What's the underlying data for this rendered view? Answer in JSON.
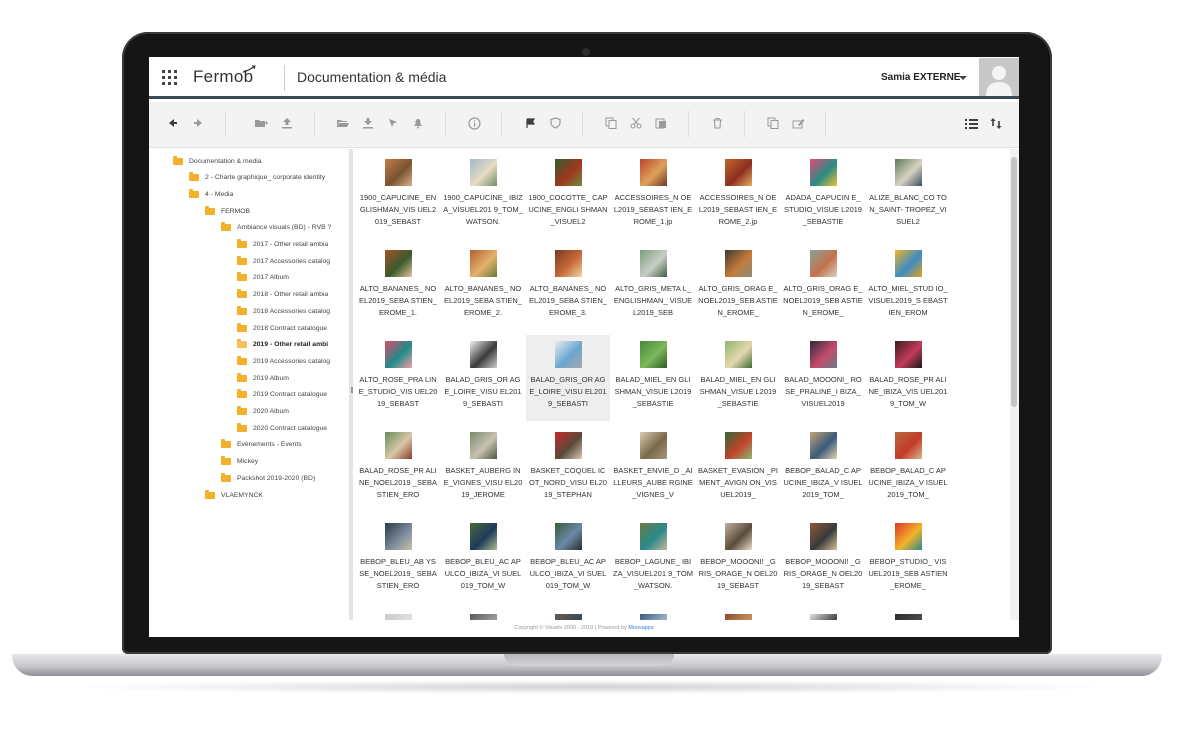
{
  "header": {
    "logo": "Fermob",
    "title": "Documentation & média",
    "user": "Samia EXTERNE",
    "icons": [
      "apps-grid-icon",
      "caret-down-icon",
      "avatar-icon"
    ]
  },
  "toolbar": {
    "icons": [
      "arrow-left-icon",
      "arrow-right-icon",
      "new-folder-icon",
      "upload-icon",
      "open-folder-icon",
      "download-icon",
      "cursor-icon",
      "bell-icon",
      "info-icon",
      "flag-icon",
      "shield-icon",
      "copy-icon",
      "cut-icon",
      "paste-icon",
      "delete-icon",
      "duplicate-icon",
      "rename-icon",
      "list-view-icon",
      "sort-icon"
    ]
  },
  "tree": [
    {
      "label": "Documentation & media",
      "level": 0
    },
    {
      "label": "2 - Charte graphique_ corporate identity",
      "level": 1
    },
    {
      "label": "4 - Media",
      "level": 1
    },
    {
      "label": "FERMOB",
      "level": 2
    },
    {
      "label": "Ambiance visuals (BD) - RVB ?",
      "level": 3
    },
    {
      "label": "2017 - Other retail ambia",
      "level": 4
    },
    {
      "label": "2017 Accessories catalog",
      "level": 4
    },
    {
      "label": "2017 Album",
      "level": 4
    },
    {
      "label": "2018 - Other retail ambia",
      "level": 4
    },
    {
      "label": "2018 Accessories catalog",
      "level": 4
    },
    {
      "label": "2018 Contract catalogue",
      "level": 4
    },
    {
      "label": "2019 - Other retail ambi",
      "level": 4,
      "active": true
    },
    {
      "label": "2019 Accessories catalog",
      "level": 4
    },
    {
      "label": "2019 Album",
      "level": 4
    },
    {
      "label": "2019 Contract catalogue",
      "level": 4
    },
    {
      "label": "2020 Album",
      "level": 4
    },
    {
      "label": "2020 Contract catalogue",
      "level": 4
    },
    {
      "label": "Evènements - Events",
      "level": 3
    },
    {
      "label": "Mickey",
      "level": 3
    },
    {
      "label": "Packshot 2019-2020 (BD)",
      "level": 3
    },
    {
      "label": "VLAEMYNCK",
      "level": 2
    }
  ],
  "files": [
    {
      "name": "1900_CAPUCINE_ ENGLISHMAN_VIS UEL2019_SEBAST",
      "colors": [
        "#c57c4a",
        "#7a5330",
        "#d9b18a"
      ]
    },
    {
      "name": "1900_CAPUCINE_ IBIZA_VISUEL201 9_TOM_WATSON.",
      "colors": [
        "#9fb9c9",
        "#e8dcc2",
        "#6f8c6a"
      ]
    },
    {
      "name": "1900_COCOTTE_ CAPUCINE_ENGLI SHMAN_VISUEL2",
      "colors": [
        "#2f5f2c",
        "#a1361f",
        "#6d8e3d"
      ]
    },
    {
      "name": "ACCESSOIRES_N OEL2019_SEBAST IEN_EROME_1.jp",
      "colors": [
        "#b8452a",
        "#e0a05c",
        "#6a3a22"
      ]
    },
    {
      "name": "ACCESSOIRES_N OEL2019_SEBAST IEN_EROME_2.jp",
      "colors": [
        "#c0672b",
        "#8d2f1f",
        "#e2b063"
      ]
    },
    {
      "name": "ADADA_CAPUCIN E_STUDIO_VISUE L2019_SEBASTIE",
      "colors": [
        "#e24a7a",
        "#2a8c84",
        "#f1c232"
      ]
    },
    {
      "name": "ALIZE_BLANC_CO TON_SAINT- TROPEZ_VISUEL2",
      "colors": [
        "#5a7a5c",
        "#d9d2c2",
        "#3a4e63"
      ]
    },
    {
      "name": "ALTO_BANANES_ NOEL2019_SEBA STIEN_EROME_1.",
      "colors": [
        "#a4522c",
        "#3b5a2c",
        "#e3c49a"
      ]
    },
    {
      "name": "ALTO_BANANES_ NOEL2019_SEBA STIEN_EROME_2.",
      "colors": [
        "#b65b2c",
        "#e4b36d",
        "#6a7a3a"
      ]
    },
    {
      "name": "ALTO_BANANES_ NOEL2019_SEBA STIEN_EROME_3.",
      "colors": [
        "#7a3a22",
        "#c86a3a",
        "#f0d7a8"
      ]
    },
    {
      "name": "ALTO_GRIS_META L_ENGLISHMAN_ VISUEL2019_SEB",
      "colors": [
        "#7b9d7a",
        "#c8cfc6",
        "#3f5d46"
      ]
    },
    {
      "name": "ALTO_GRIS_ORAG E_NOEL2019_SEB ASTIEN_EROME_",
      "colors": [
        "#3a3a34",
        "#c47b3a",
        "#8a8c7a"
      ]
    },
    {
      "name": "ALTO_GRIS_ORAG E_NOEL2019_SEB ASTIEN_EROME_",
      "colors": [
        "#8aa39a",
        "#c4714a",
        "#d8d2c4"
      ]
    },
    {
      "name": "ALTO_MIEL_STUD IO_VISUEL2019_S EBASTIEN_EROM",
      "colors": [
        "#f0b428",
        "#3a8cc4",
        "#e6a21e"
      ]
    },
    {
      "name": "ALTO_ROSE_PRA LINE_STUDIO_VIS UEL2019_SEBAST",
      "colors": [
        "#e04a6a",
        "#1f8c8a",
        "#f2a0a8"
      ]
    },
    {
      "name": "BALAD_GRIS_OR AGE_LOIRE_VISU EL2019_SEBASTI",
      "colors": [
        "#f2f2f2",
        "#3a3a3a",
        "#cfcfcf"
      ]
    },
    {
      "name": "BALAD_GRIS_OR AGE_LOIRE_VISU EL2019_SEBASTI",
      "colors": [
        "#e8eef3",
        "#6aa6cf",
        "#a8a8a8"
      ],
      "selected": true
    },
    {
      "name": "BALAD_MIEL_EN GLISHMAN_VISUE L2019_SEBASTIE",
      "colors": [
        "#4a8a3a",
        "#7ab85a",
        "#2e5a22"
      ]
    },
    {
      "name": "BALAD_MIEL_EN GLISHMAN_VISUE L2019_SEBASTIE",
      "colors": [
        "#8ab86a",
        "#e6d7b0",
        "#3f6e30"
      ]
    },
    {
      "name": "BALAD_MOOONI_ ROSE_PRALINE_I BIZA_VISUEL2019",
      "colors": [
        "#2a2a3a",
        "#c44a6a",
        "#6a7a8a"
      ]
    },
    {
      "name": "BALAD_ROSE_PR ALINE_IBIZA_VIS UEL2019_TOM_W",
      "colors": [
        "#3a1e1e",
        "#c23a5a",
        "#1a1a1a"
      ]
    },
    {
      "name": "BALAD_ROSE_PR ALINE_NOEL2019 _SEBASTIEN_ERO",
      "colors": [
        "#6a8a5a",
        "#d8c8a8",
        "#8a3a2a"
      ]
    },
    {
      "name": "BASKET_AUBERG INE_VIGNES_VISU EL2019_JEROME",
      "colors": [
        "#7a8a6a",
        "#c8c2b2",
        "#4a5a3a"
      ]
    },
    {
      "name": "BASKET_COQUEL ICOT_NORD_VISU EL2019_STEPHAN",
      "colors": [
        "#c42a2a",
        "#5a4a3a",
        "#d6cab8"
      ]
    },
    {
      "name": "BASKET_ENVIE_D _AILLEURS_AUBE RGINE_VIGNES_V",
      "colors": [
        "#d8ccb2",
        "#7a6a4a",
        "#a89a7a"
      ]
    },
    {
      "name": "BASKET_EVASION _PIMENT_AVIGN ON_VISUEL2019_",
      "colors": [
        "#2a6a3a",
        "#c4432a",
        "#8ab870"
      ]
    },
    {
      "name": "BEBOP_BALAD_C APUCINE_IBIZA_V ISUEL2019_TOM_",
      "colors": [
        "#c4a27a",
        "#3a5a7a",
        "#e6d2b2"
      ]
    },
    {
      "name": "BEBOP_BALAD_C APUCINE_IBIZA_V ISUEL2019_TOM_",
      "colors": [
        "#b86a3a",
        "#c23a2a",
        "#d8b88a"
      ]
    },
    {
      "name": "BEBOP_BLEU_AB YSSE_NOEL2019_ SEBASTIEN_ERO",
      "colors": [
        "#2a3a4a",
        "#7a8a9a",
        "#c8c0b0"
      ]
    },
    {
      "name": "BEBOP_BLEU_AC APULCO_IBIZA_VI SUEL019_TOM_W",
      "colors": [
        "#4a6a3a",
        "#1f3a5a",
        "#a8c090"
      ]
    },
    {
      "name": "BEBOP_BLEU_AC APULCO_IBIZA_VI SUEL019_TOM_W",
      "colors": [
        "#3a5a3a",
        "#6a8aa8",
        "#2a2a2a"
      ]
    },
    {
      "name": "BEBOP_LAGUNE_ IBIZA_VISUEL201 9_TOM_WATSON.",
      "colors": [
        "#6a7a4a",
        "#2a8a8a",
        "#c8b89a"
      ]
    },
    {
      "name": "BEBOP_MOOONI! _GRIS_ORAGE_N OEL2019_SEBAST",
      "colors": [
        "#c2b2a2",
        "#5a4a3a",
        "#e8dcc8"
      ]
    },
    {
      "name": "BEBOP_MOOONI! _GRIS_ORAGE_N OEL2019_SEBAST",
      "colors": [
        "#8a5a3a",
        "#3a3a3a",
        "#d8c2a2"
      ]
    },
    {
      "name": "BEBOP_STUDIO_ VISUEL2019_SEB ASTIEN_EROME_",
      "colors": [
        "#e2332a",
        "#f0b428",
        "#2a8a8a"
      ]
    },
    {
      "name": "",
      "colors": [
        "#c8c8c8",
        "#e0e0e0",
        "#b0b0b0"
      ]
    },
    {
      "name": "",
      "colors": [
        "#5a5a5a",
        "#9a9a9a",
        "#3a3a3a"
      ]
    },
    {
      "name": "",
      "colors": [
        "#6a5a4a",
        "#3a4a5a",
        "#8a7a6a"
      ]
    },
    {
      "name": "",
      "colors": [
        "#3a5a7a",
        "#9ab0c8",
        "#5a6a7a"
      ]
    },
    {
      "name": "",
      "colors": [
        "#8a4a2a",
        "#c8905a",
        "#6a3a22"
      ]
    },
    {
      "name": "",
      "colors": [
        "#e0e0e0",
        "#4a4a4a",
        "#a0a0a0"
      ]
    },
    {
      "name": "",
      "colors": [
        "#2a2a2a",
        "#4a4a4a",
        "#1a1a1a"
      ]
    }
  ],
  "footer": {
    "text": "Copyright © Visiativ 2000 - 2019 | Powered by",
    "link": "Moovapps"
  }
}
